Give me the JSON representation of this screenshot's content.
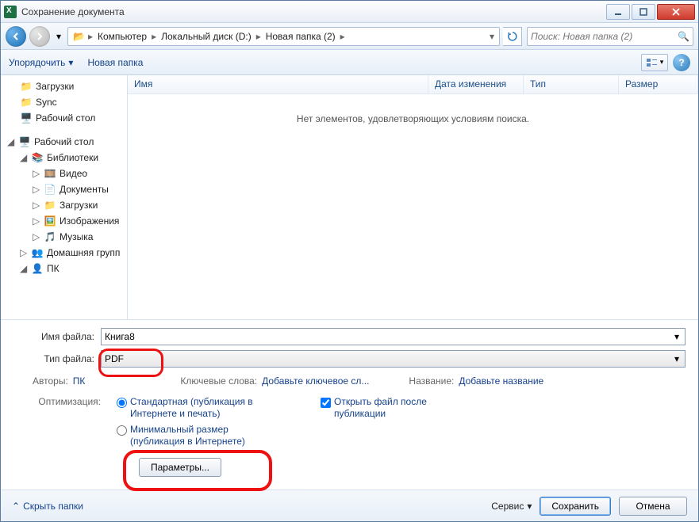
{
  "title": "Сохранение документа",
  "breadcrumb": {
    "root": "Компьютер",
    "drive": "Локальный диск (D:)",
    "folder": "Новая папка (2)"
  },
  "search": {
    "placeholder": "Поиск: Новая папка (2)"
  },
  "toolbar": {
    "organize": "Упорядочить",
    "newfolder": "Новая папка"
  },
  "tree": {
    "downloads": "Загрузки",
    "sync": "Sync",
    "desktop1": "Рабочий стол",
    "desktop2": "Рабочий стол",
    "libraries": "Библиотеки",
    "video": "Видео",
    "documents": "Документы",
    "downloads2": "Загрузки",
    "images": "Изображения",
    "music": "Музыка",
    "homegroup": "Домашняя групп",
    "pc": "ПК"
  },
  "list": {
    "col_name": "Имя",
    "col_date": "Дата изменения",
    "col_type": "Тип",
    "col_size": "Размер",
    "empty": "Нет элементов, удовлетворяющих условиям поиска."
  },
  "form": {
    "filename_label": "Имя файла:",
    "filename_value": "Книга8",
    "filetype_label": "Тип файла:",
    "filetype_value": "PDF",
    "authors_label": "Авторы:",
    "authors_value": "ПК",
    "keywords_label": "Ключевые слова:",
    "keywords_link": "Добавьте ключевое сл...",
    "title_label": "Название:",
    "title_link": "Добавьте название",
    "optimize_label": "Оптимизация:",
    "opt_standard": "Стандартная (публикация в Интернете и печать)",
    "opt_min": "Минимальный размер (публикация в Интернете)",
    "open_after": "Открыть файл после публикации",
    "params_btn": "Параметры..."
  },
  "footer": {
    "hide_folders": "Скрыть папки",
    "service": "Сервис",
    "save": "Сохранить",
    "cancel": "Отмена"
  }
}
